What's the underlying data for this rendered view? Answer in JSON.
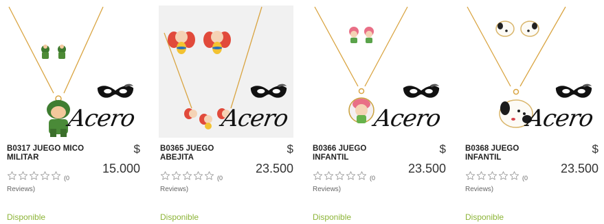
{
  "products": [
    {
      "name": "B0317 JUEGO MICO MILITAR",
      "currency": "$",
      "price": "15.000",
      "review_count": "(0",
      "reviews_label": "Reviews)",
      "availability": "Disponible",
      "brand_watermark": "Acero",
      "image_icon": "soldier-necklace-icon",
      "rating": 0,
      "max_rating": 5
    },
    {
      "name": "B0365 JUEGO ABEJITA",
      "currency": "$",
      "price": "23.500",
      "review_count": "(0",
      "reviews_label": "Reviews)",
      "availability": "Disponible",
      "brand_watermark": "Acero",
      "image_icon": "bee-necklace-icon",
      "rating": 0,
      "max_rating": 5
    },
    {
      "name": "B0366 JUEGO INFANTIL",
      "currency": "$",
      "price": "23.500",
      "review_count": "(0",
      "reviews_label": "Reviews)",
      "availability": "Disponible",
      "brand_watermark": "Acero",
      "image_icon": "girl-necklace-icon",
      "rating": 0,
      "max_rating": 5
    },
    {
      "name": "B0368 JUEGO INFANTIL",
      "currency": "$",
      "price": "23.500",
      "review_count": "(0",
      "reviews_label": "Reviews)",
      "availability": "Disponible",
      "brand_watermark": "Acero",
      "image_icon": "puppy-necklace-icon",
      "rating": 0,
      "max_rating": 5
    }
  ],
  "colors": {
    "availability": "#8cb437",
    "gold": "#d9a441",
    "star_outline": "#9a9a9a"
  }
}
